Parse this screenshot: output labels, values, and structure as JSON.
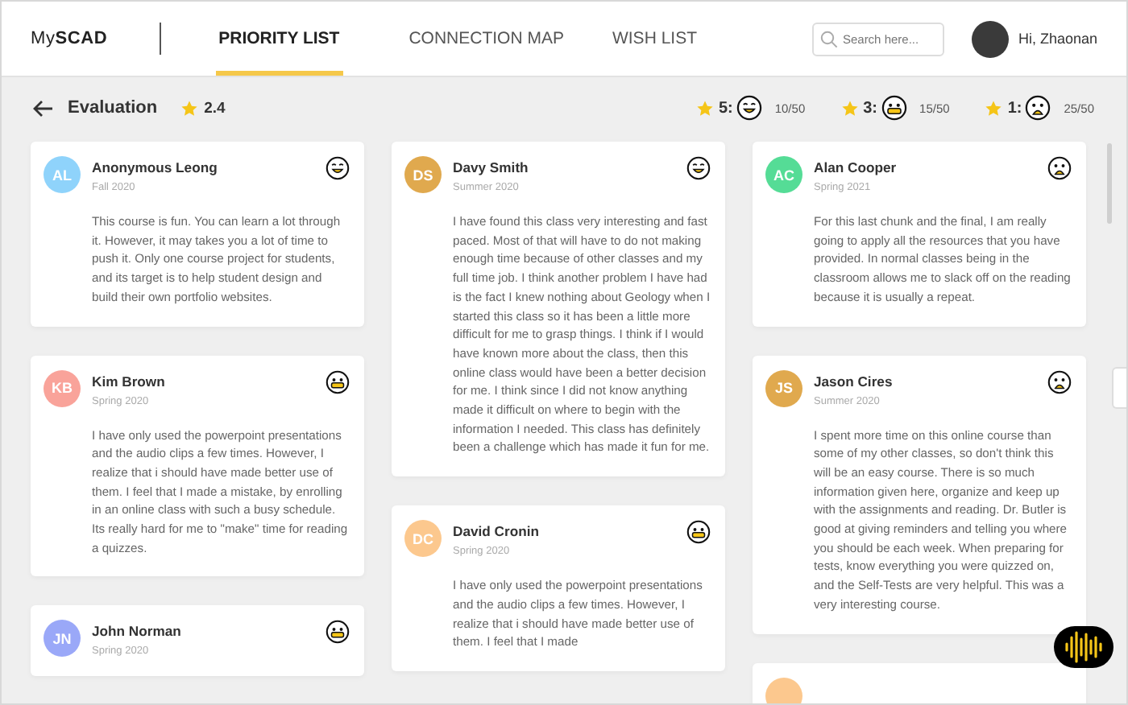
{
  "brand": {
    "plain": "My",
    "bold": "SCAD"
  },
  "tabs": [
    {
      "label": "PRIORITY LIST",
      "selected": true
    },
    {
      "label": "CONNECTION MAP",
      "selected": false
    },
    {
      "label": "WISH LIST",
      "selected": false
    }
  ],
  "search": {
    "placeholder": "Search here..."
  },
  "user": {
    "greeting": "Hi, Zhaonan"
  },
  "evaluation": {
    "title": "Evaluation",
    "rating": "2.4",
    "summary": [
      {
        "stars": "5:",
        "kind": "happy",
        "count": "10/50"
      },
      {
        "stars": "3:",
        "kind": "meh",
        "count": "15/50"
      },
      {
        "stars": "1:",
        "kind": "sad",
        "count": "25/50"
      }
    ]
  },
  "columns": [
    {
      "reviews": [
        {
          "initials": "AL",
          "color": "#8fd3fb",
          "name": "Anonymous Leong",
          "term": "Fall 2020",
          "kind": "happy",
          "text": "This course is fun. You can learn a lot through it. However, it may takes you a lot of time to push it. Only one course project for students, and its target is to help student design and build their own portfolio websites."
        },
        {
          "initials": "KB",
          "color": "#f9a39a",
          "name": "Kim Brown",
          "term": "Spring 2020",
          "kind": "meh",
          "text": "I have only used the powerpoint presentations and the audio clips a few times. However, I realize that i should have made better use of them. I feel that I made a mistake, by enrolling in an online class with such a busy schedule. Its really hard for me to \"make\" time for reading a quizzes."
        },
        {
          "initials": "JN",
          "color": "#9aa8f8",
          "name": "John Norman",
          "term": "Spring 2020",
          "kind": "meh"
        }
      ]
    },
    {
      "reviews": [
        {
          "initials": "DS",
          "color": "#e0a94e",
          "name": "Davy Smith",
          "term": "Summer 2020",
          "kind": "happy",
          "text": "I have found this class very interesting and fast paced. Most of that will have to do not making enough time because of other classes and my full time job. I think another problem I have had is the fact I knew nothing about Geology when I started this class so it has been a little more difficult for me to grasp things. I think if I would have known more about the class, then this online class would have been a better decision for me. I think since I did not know anything made it difficult on where to begin with the information I needed. This class has definitely been a challenge which has made it fun for me."
        },
        {
          "initials": "DC",
          "color": "#fcc88e",
          "name": "David Cronin",
          "term": "Spring 2020",
          "kind": "meh",
          "text": "I have only used the powerpoint presentations and the audio clips a few times. However, I realize that i should have made better use of them. I feel that I made"
        }
      ]
    },
    {
      "reviews": [
        {
          "initials": "AC",
          "color": "#55dc96",
          "name": "Alan Cooper",
          "term": "Spring 2021",
          "kind": "sad",
          "text": "For this last chunk and the final, I am really going to apply all the resources that you have provided. In normal classes being in the classroom allows me to slack off on the reading because it is usually a repeat."
        },
        {
          "initials": "JS",
          "color": "#e0a94e",
          "name": "Jason Cires",
          "term": "Summer 2020",
          "kind": "sad",
          "text": "I spent more time on this online course than some of my other classes, so don't think this will be an easy course. There is so much information given here, organize and keep up with the assignments and reading. Dr. Butler is good at giving reminders and telling you where you should be each week. When preparing for tests, know everything you were quizzed on, and the Self-Tests are very helpful. This was a very interesting course."
        },
        {
          "color": "#fcc88e",
          "kind": "none"
        }
      ]
    }
  ]
}
